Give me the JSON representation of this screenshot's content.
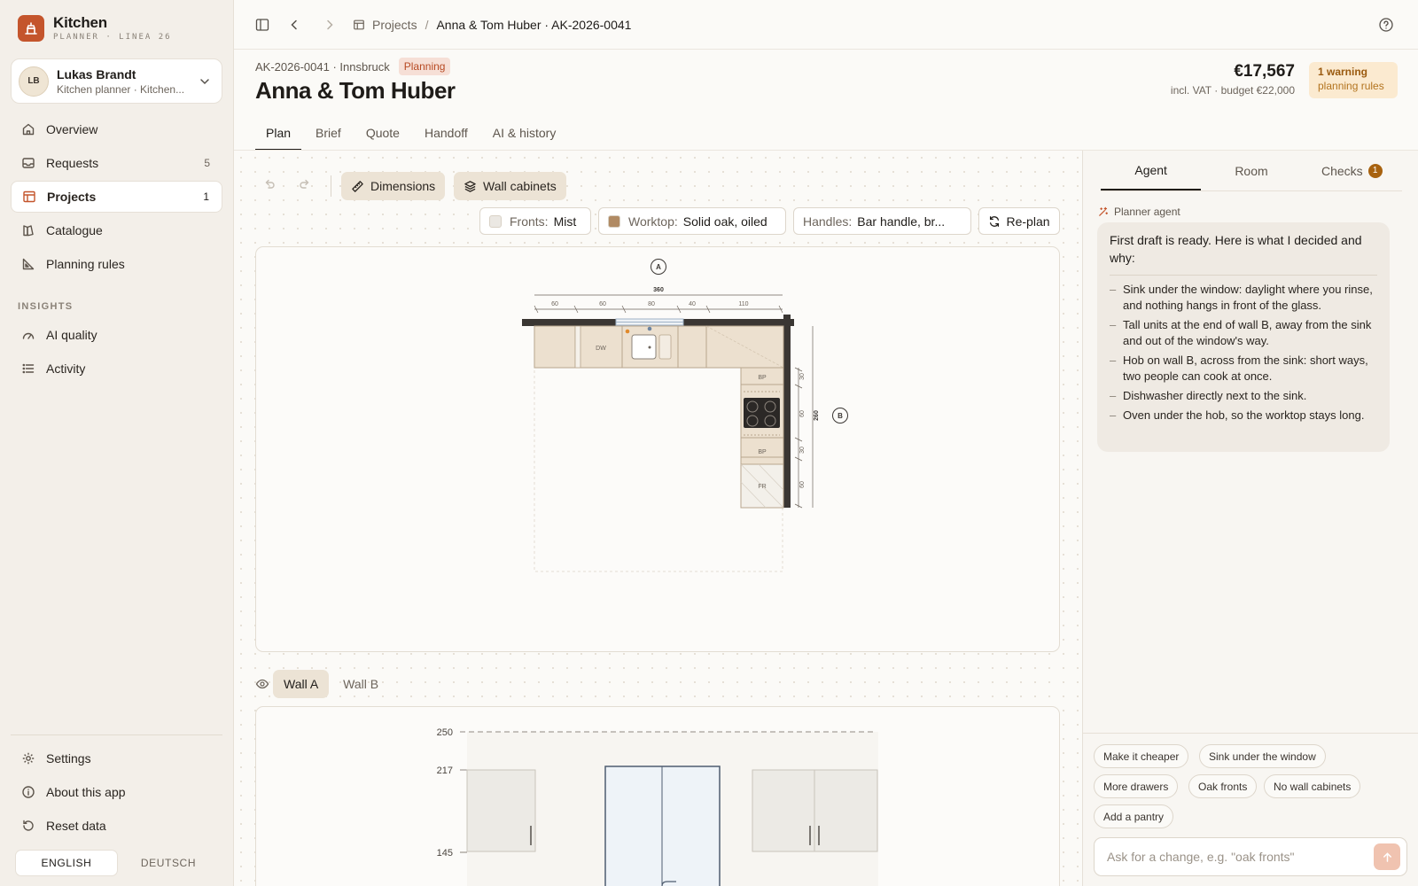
{
  "app": {
    "name": "Kitchen",
    "subtitle": "PLANNER · LINEA 26"
  },
  "user": {
    "initials": "LB",
    "name": "Lukas Brandt",
    "role": "Kitchen planner · Kitchen..."
  },
  "nav": {
    "items": [
      {
        "label": "Overview",
        "icon": "home-icon",
        "count": ""
      },
      {
        "label": "Requests",
        "icon": "inbox-icon",
        "count": "5"
      },
      {
        "label": "Projects",
        "icon": "layout-icon",
        "count": "1",
        "active": true
      },
      {
        "label": "Catalogue",
        "icon": "catalogue-icon",
        "count": ""
      },
      {
        "label": "Planning rules",
        "icon": "ruler-icon",
        "count": ""
      }
    ],
    "insights_label": "INSIGHTS",
    "insights": [
      {
        "label": "AI quality",
        "icon": "gauge-icon"
      },
      {
        "label": "Activity",
        "icon": "list-icon"
      }
    ],
    "footer": [
      {
        "label": "Settings",
        "icon": "gear-icon"
      },
      {
        "label": "About this app",
        "icon": "info-icon"
      },
      {
        "label": "Reset data",
        "icon": "reset-icon"
      }
    ]
  },
  "language": {
    "english": "ENGLISH",
    "deutsch": "DEUTSCH",
    "active": "english"
  },
  "breadcrumb": {
    "parent": "Projects",
    "separator": "/",
    "current": "Anna & Tom Huber · AK-2026-0041"
  },
  "project": {
    "meta": "AK-2026-0041 · Innsbruck",
    "status": "Planning",
    "title": "Anna & Tom Huber",
    "price": "€17,567",
    "price_note": "incl. VAT · budget €22,000",
    "warning_count": "1 warning",
    "warning_source": "planning rules"
  },
  "tabs": [
    "Plan",
    "Brief",
    "Quote",
    "Handoff",
    "AI & history"
  ],
  "toolbar": {
    "dimensions": "Dimensions",
    "wall_cabinets": "Wall cabinets",
    "fronts_label": "Fronts:",
    "fronts_value": "Mist",
    "fronts_color": "#ebe8e3",
    "worktop_label": "Worktop:",
    "worktop_value": "Solid oak, oiled",
    "worktop_color": "#b08a63",
    "handles_label": "Handles:",
    "handles_value": "Bar handle, br...",
    "replan": "Re-plan"
  },
  "plan": {
    "wall_a_marker": "A",
    "wall_b_marker": "B",
    "total_width": "360",
    "segments": [
      "60",
      "60",
      "80",
      "40",
      "110"
    ],
    "side_length": "260",
    "side_segments": [
      "30",
      "60",
      "30",
      "60"
    ],
    "labels": {
      "dishwasher": "DW",
      "filler_top": "BP",
      "filler_bottom": "BP",
      "fridge": "FR"
    }
  },
  "elevation": {
    "tabs": [
      "Wall A",
      "Wall B"
    ],
    "levels": [
      "250",
      "217",
      "145"
    ]
  },
  "panel": {
    "tabs": [
      "Agent",
      "Room",
      "Checks"
    ],
    "checks_count": "1",
    "agent_name": "Planner agent",
    "intro": "First draft is ready. Here is what I decided and why:",
    "reasons": [
      "Sink under the window: daylight where you rinse, and nothing hangs in front of the glass.",
      "Tall units at the end of wall B, away from the sink and out of the window's way.",
      "Hob on wall B, across from the sink: short ways, two people can cook at once.",
      "Dishwasher directly next to the sink.",
      "Oven under the hob, so the worktop stays long."
    ],
    "suggestions": [
      "Make it cheaper",
      "Sink under the window",
      "More drawers",
      "Oak fronts",
      "No wall cabinets",
      "Add a pantry"
    ],
    "placeholder": "Ask for a change, e.g. \"oak fronts\""
  }
}
